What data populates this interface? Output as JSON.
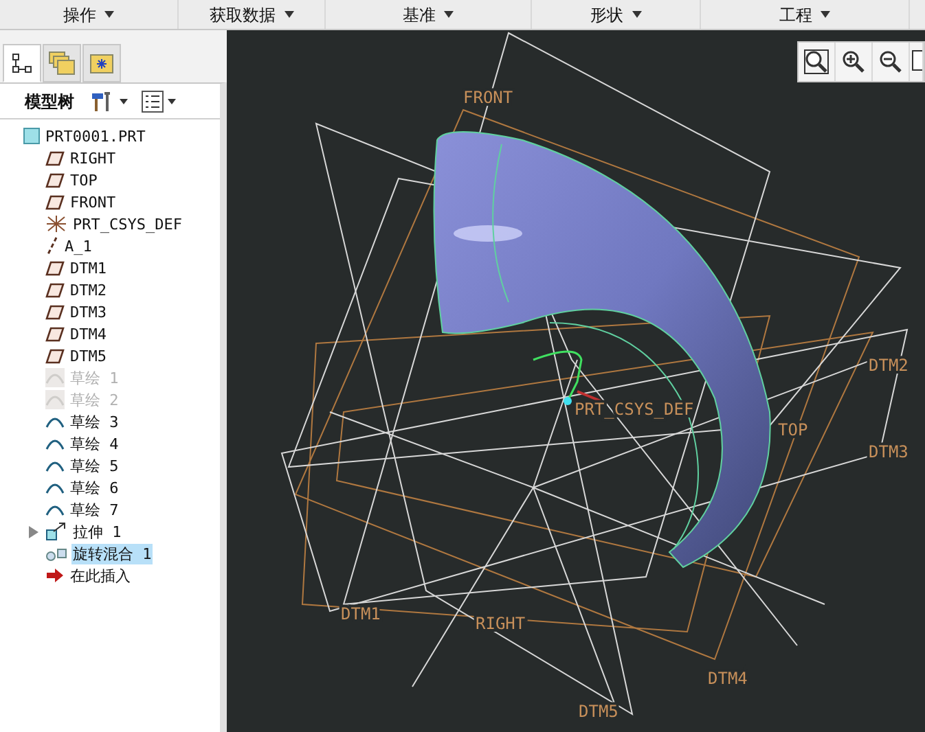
{
  "menu": [
    {
      "label": "操作"
    },
    {
      "label": "获取数据"
    },
    {
      "label": "基准"
    },
    {
      "label": "形状"
    },
    {
      "label": "工程"
    }
  ],
  "panel_tabs": [
    {
      "kind": "tree",
      "selected": true
    },
    {
      "kind": "layers",
      "selected": false
    },
    {
      "kind": "favorites",
      "selected": false
    }
  ],
  "model_tree": {
    "title": "模型树",
    "items": [
      {
        "kind": "part",
        "label": "PRT0001.PRT",
        "hidden": false,
        "selected": false,
        "children": [
          {
            "kind": "plane",
            "label": "RIGHT",
            "hidden": false,
            "selected": false
          },
          {
            "kind": "plane",
            "label": "TOP",
            "hidden": false,
            "selected": false
          },
          {
            "kind": "plane",
            "label": "FRONT",
            "hidden": false,
            "selected": false
          },
          {
            "kind": "csys",
            "label": "PRT_CSYS_DEF",
            "hidden": false,
            "selected": false
          },
          {
            "kind": "axis",
            "label": "A_1",
            "hidden": false,
            "selected": false
          },
          {
            "kind": "plane",
            "label": "DTM1",
            "hidden": false,
            "selected": false
          },
          {
            "kind": "plane",
            "label": "DTM2",
            "hidden": false,
            "selected": false
          },
          {
            "kind": "plane",
            "label": "DTM3",
            "hidden": false,
            "selected": false
          },
          {
            "kind": "plane",
            "label": "DTM4",
            "hidden": false,
            "selected": false
          },
          {
            "kind": "plane",
            "label": "DTM5",
            "hidden": false,
            "selected": false
          },
          {
            "kind": "sketch",
            "label": "草绘 1",
            "hidden": true,
            "selected": false
          },
          {
            "kind": "sketch",
            "label": "草绘 2",
            "hidden": true,
            "selected": false
          },
          {
            "kind": "sketch",
            "label": "草绘 3",
            "hidden": false,
            "selected": false
          },
          {
            "kind": "sketch",
            "label": "草绘 4",
            "hidden": false,
            "selected": false
          },
          {
            "kind": "sketch",
            "label": "草绘 5",
            "hidden": false,
            "selected": false
          },
          {
            "kind": "sketch",
            "label": "草绘 6",
            "hidden": false,
            "selected": false
          },
          {
            "kind": "sketch",
            "label": "草绘 7",
            "hidden": false,
            "selected": false
          },
          {
            "kind": "extrude",
            "label": "拉伸 1",
            "hidden": false,
            "selected": false,
            "expanded": false
          },
          {
            "kind": "blend",
            "label": "旋转混合 1",
            "hidden": false,
            "selected": true
          },
          {
            "kind": "insert",
            "label": "在此插入",
            "hidden": false,
            "selected": false
          }
        ]
      }
    ]
  },
  "view_toolbar": [
    {
      "kind": "zoom-fit"
    },
    {
      "kind": "zoom-in"
    },
    {
      "kind": "zoom-out"
    },
    {
      "kind": "more"
    }
  ],
  "view_labels": [
    {
      "text": "FRONT"
    },
    {
      "text": "DTM2"
    },
    {
      "text": "PRT_CSYS_DEF"
    },
    {
      "text": "TOP"
    },
    {
      "text": "DTM3"
    },
    {
      "text": "DTM1"
    },
    {
      "text": "RIGHT"
    },
    {
      "text": "DTM4"
    },
    {
      "text": "DTM5"
    }
  ]
}
